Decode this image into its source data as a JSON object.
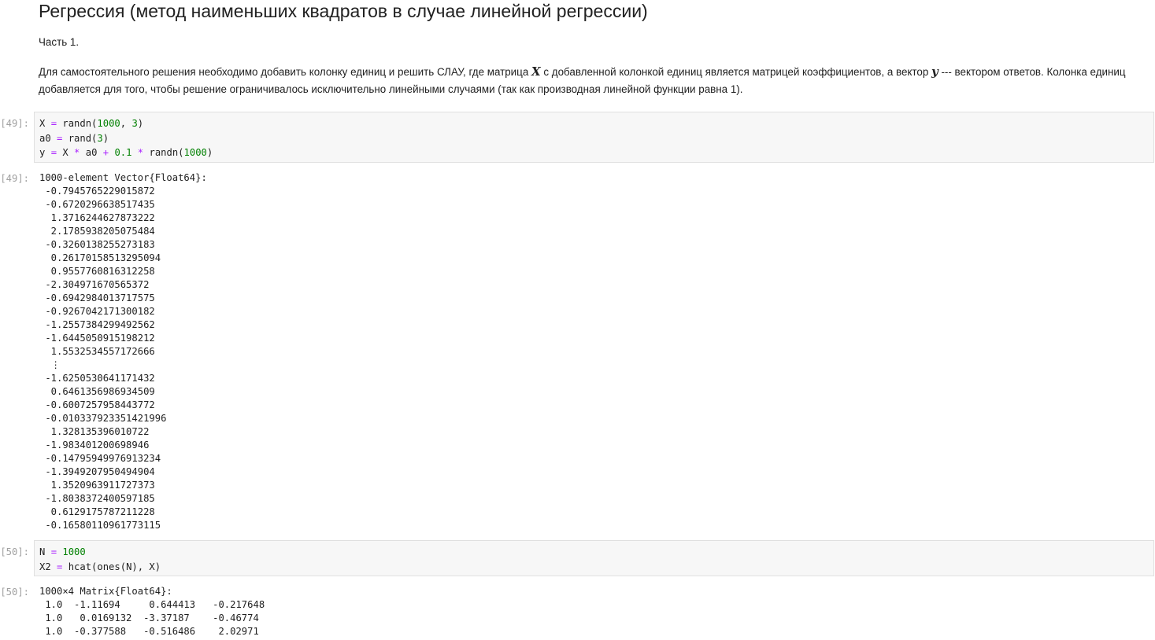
{
  "markdown": {
    "title": "Регрессия (метод наименьших квадратов в случае линейной регрессии)",
    "part": "Часть 1.",
    "paragraph": {
      "text_1": "Для самостоятельного решения необходимо добавить колонку единиц и решить СЛАУ, где матрица ",
      "var_X": "X",
      "text_2": " с добавленной колонкой единиц является матрицей коэффициентов, а вектор ",
      "var_y": "y",
      "text_3": " --- вектором ответов. Колонка единиц добавляется для того, чтобы решение ограничивалось исключительно линейными случаями (так как производная линейной функции равна 1)."
    }
  },
  "cells": [
    {
      "input_prompt": "[49]:",
      "output_prompt": "[49]:",
      "code_lines": [
        [
          {
            "t": "X "
          },
          {
            "t": "=",
            "c": "op"
          },
          {
            "t": " randn("
          },
          {
            "t": "1000",
            "c": "num"
          },
          {
            "t": ", "
          },
          {
            "t": "3",
            "c": "num"
          },
          {
            "t": ")"
          }
        ],
        [
          {
            "t": "a0 "
          },
          {
            "t": "=",
            "c": "op"
          },
          {
            "t": " rand("
          },
          {
            "t": "3",
            "c": "num"
          },
          {
            "t": ")"
          }
        ],
        [
          {
            "t": "y "
          },
          {
            "t": "=",
            "c": "op"
          },
          {
            "t": " X "
          },
          {
            "t": "*",
            "c": "op"
          },
          {
            "t": " a0 "
          },
          {
            "t": "+",
            "c": "op"
          },
          {
            "t": " "
          },
          {
            "t": "0.1",
            "c": "num"
          },
          {
            "t": " "
          },
          {
            "t": "*",
            "c": "op"
          },
          {
            "t": " randn("
          },
          {
            "t": "1000",
            "c": "num"
          },
          {
            "t": ")"
          }
        ]
      ],
      "output_lines": [
        "1000-element Vector{Float64}:",
        " -0.7945765229015872",
        " -0.6720296638517435",
        "  1.3716244627873222",
        "  2.1785938205075484",
        " -0.3260138255273183",
        "  0.26170158513295094",
        "  0.9557760816312258",
        " -2.304971670565372",
        " -0.6942984013717575",
        " -0.9267042171300182",
        " -1.2557384299492562",
        " -1.6445050915198212",
        "  1.5532534557172666",
        "  ⋮",
        " -1.6250530641171432",
        "  0.6461356986934509",
        " -0.6007257958443772",
        " -0.010337923351421996",
        "  1.328135396010722",
        " -1.983401200698946",
        " -0.14795949976913234",
        " -1.3949207950494904",
        "  1.3520963911727373",
        " -1.8038372400597185",
        "  0.6129175787211228",
        " -0.16580110961773115"
      ]
    },
    {
      "input_prompt": "[50]:",
      "output_prompt": "[50]:",
      "code_lines": [
        [
          {
            "t": "N "
          },
          {
            "t": "=",
            "c": "op"
          },
          {
            "t": " "
          },
          {
            "t": "1000",
            "c": "num"
          }
        ],
        [
          {
            "t": "X2 "
          },
          {
            "t": "=",
            "c": "op"
          },
          {
            "t": " hcat(ones(N), X)"
          }
        ]
      ],
      "output_lines": [
        "1000×4 Matrix{Float64}:",
        " 1.0  -1.11694     0.644413   -0.217648",
        " 1.0   0.0169132  -3.37187    -0.46774",
        " 1.0  -0.377588   -0.516486    2.02971"
      ]
    }
  ]
}
